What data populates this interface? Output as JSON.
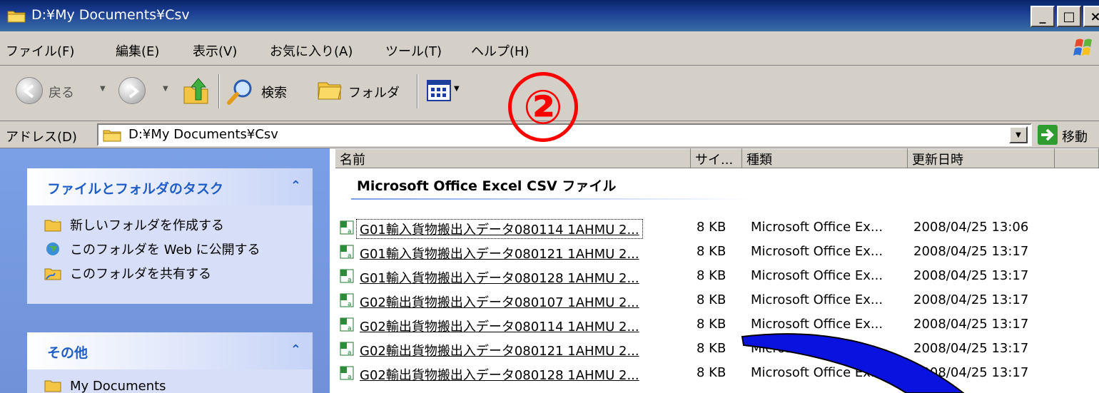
{
  "window": {
    "title": "D:¥My Documents¥Csv",
    "buttons": [
      "_",
      "□",
      "×"
    ]
  },
  "menubar": {
    "items": [
      "ファイル(F)",
      "編集(E)",
      "表示(V)",
      "お気に入り(A)",
      "ツール(T)",
      "ヘルプ(H)"
    ]
  },
  "toolbar": {
    "back_label": "戻る",
    "search_label": "検索",
    "folders_label": "フォルダ"
  },
  "annotation": {
    "number": "②"
  },
  "address": {
    "label": "アドレス(D)",
    "value": "D:¥My Documents¥Csv",
    "go_label": "移動"
  },
  "taskpane": {
    "file_tasks": {
      "title": "ファイルとフォルダのタスク",
      "items": [
        "新しいフォルダを作成する",
        "このフォルダを Web に公開する",
        "このフォルダを共有する"
      ]
    },
    "other": {
      "title": "その他",
      "items": [
        "My Documents"
      ]
    }
  },
  "listview": {
    "columns": [
      "名前",
      "サイ...",
      "種類",
      "更新日時"
    ],
    "group_title": "Microsoft Office Excel CSV ファイル",
    "rows": [
      {
        "name": "G01輸入貨物搬出入データ080114 1AHMU 2...",
        "size": "8 KB",
        "type": "Microsoft Office Ex...",
        "date": "2008/04/25 13:06"
      },
      {
        "name": "G01輸入貨物搬出入データ080121 1AHMU 2...",
        "size": "8 KB",
        "type": "Microsoft Office Ex...",
        "date": "2008/04/25 13:17"
      },
      {
        "name": "G01輸入貨物搬出入データ080128 1AHMU 2...",
        "size": "8 KB",
        "type": "Microsoft Office Ex...",
        "date": "2008/04/25 13:17"
      },
      {
        "name": "G02輸出貨物搬出入データ080107 1AHMU 2...",
        "size": "8 KB",
        "type": "Microsoft Office Ex...",
        "date": "2008/04/25 13:17"
      },
      {
        "name": "G02輸出貨物搬出入データ080114 1AHMU 2...",
        "size": "8 KB",
        "type": "Microsoft Office Ex...",
        "date": "2008/04/25 13:17"
      },
      {
        "name": "G02輸出貨物搬出入データ080121 1AHMU 2...",
        "size": "8 KB",
        "type": "Microsoft Office Ex...",
        "date": "2008/04/25 13:17"
      },
      {
        "name": "G02輸出貨物搬出入データ080128 1AHMU 2...",
        "size": "8 KB",
        "type": "Microsoft Office Ex...",
        "date": "2008/04/25 13:17"
      }
    ]
  },
  "colors": {
    "title_bar": "#0a246a",
    "annotation": "#ff0000",
    "arrow": "#0000ff",
    "taskpane_bg": "#6f91d8"
  },
  "icons": [
    "folder-icon",
    "back-icon",
    "forward-icon",
    "up-folder-icon",
    "search-icon",
    "folders-icon",
    "views-icon",
    "go-icon",
    "excel-csv-icon",
    "new-folder-icon",
    "web-publish-icon",
    "share-folder-icon",
    "windows-logo-icon"
  ]
}
